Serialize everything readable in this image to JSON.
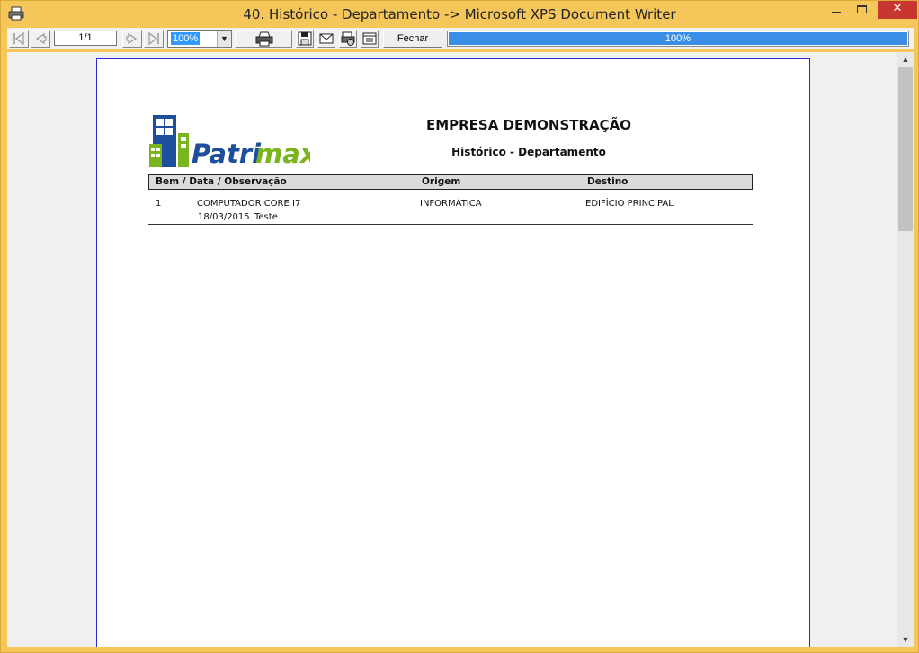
{
  "window": {
    "title": "40. Histórico - Departamento -> Microsoft XPS Document Writer",
    "minimize_icon": "minimize-icon",
    "maximize_icon": "maximize-icon",
    "close_icon": "close-icon",
    "close_glyph": "✕",
    "close_color": "#c7372f"
  },
  "toolbar": {
    "page_indicator": "1/1",
    "zoom_value": "100%",
    "close_label": "Fechar",
    "progress_text": "100%",
    "progress_value": 1.0,
    "progress_color": "#3a8ee6",
    "icons": [
      "first-page-icon",
      "prev-page-icon",
      "next-page-icon",
      "last-page-icon",
      "printer-icon",
      "save-icon",
      "email-icon",
      "print-setup-icon",
      "page-setup-icon"
    ]
  },
  "report": {
    "logo_text_1": "Patri",
    "logo_text_2": "max",
    "logo_color_blue": "#1d4f9c",
    "logo_color_green": "#7ab51d",
    "company": "EMPRESA DEMONSTRAÇÃO",
    "title": "Histórico - Departamento",
    "columns": [
      "Bem / Data / Observação",
      "Origem",
      "Destino"
    ],
    "rows": [
      {
        "id": "1",
        "description": "COMPUTADOR CORE I7",
        "date": "18/03/2015",
        "observation": "Teste",
        "origin": "INFORMÁTICA",
        "destination": "EDIFÍCIO PRINCIPAL"
      }
    ]
  }
}
